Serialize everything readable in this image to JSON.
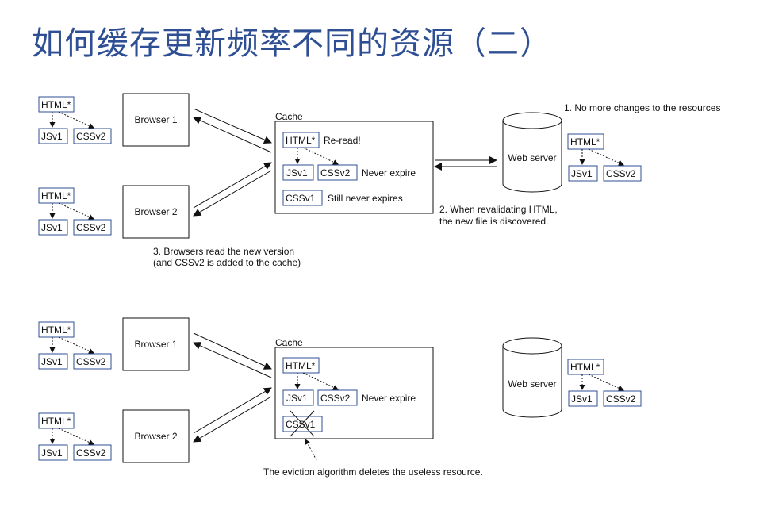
{
  "title": "如何缓存更新频率不同的资源（二）",
  "labels": {
    "html": "HTML*",
    "jsv1": "JSv1",
    "cssv2": "CSSv2",
    "cssv1": "CSSv1",
    "browser1": "Browser 1",
    "browser2": "Browser 2",
    "cache": "Cache",
    "web_server": "Web server",
    "re_read": "Re-read!",
    "never_expire": "Never expire",
    "still_never_expires": "Still never expires"
  },
  "annotations": {
    "note1": "1. No more changes to the resources",
    "note2_line1": "2. When revalidating HTML,",
    "note2_line2": "the new file is discovered.",
    "note3_line1": "3. Browsers read the new version",
    "note3_line2": "(and CSSv2 is added to the cache)",
    "eviction": "The eviction algorithm deletes the useless resource."
  },
  "colors": {
    "title": "#2f4f94",
    "box_stroke": "#2f4f94",
    "line": "#111111"
  }
}
